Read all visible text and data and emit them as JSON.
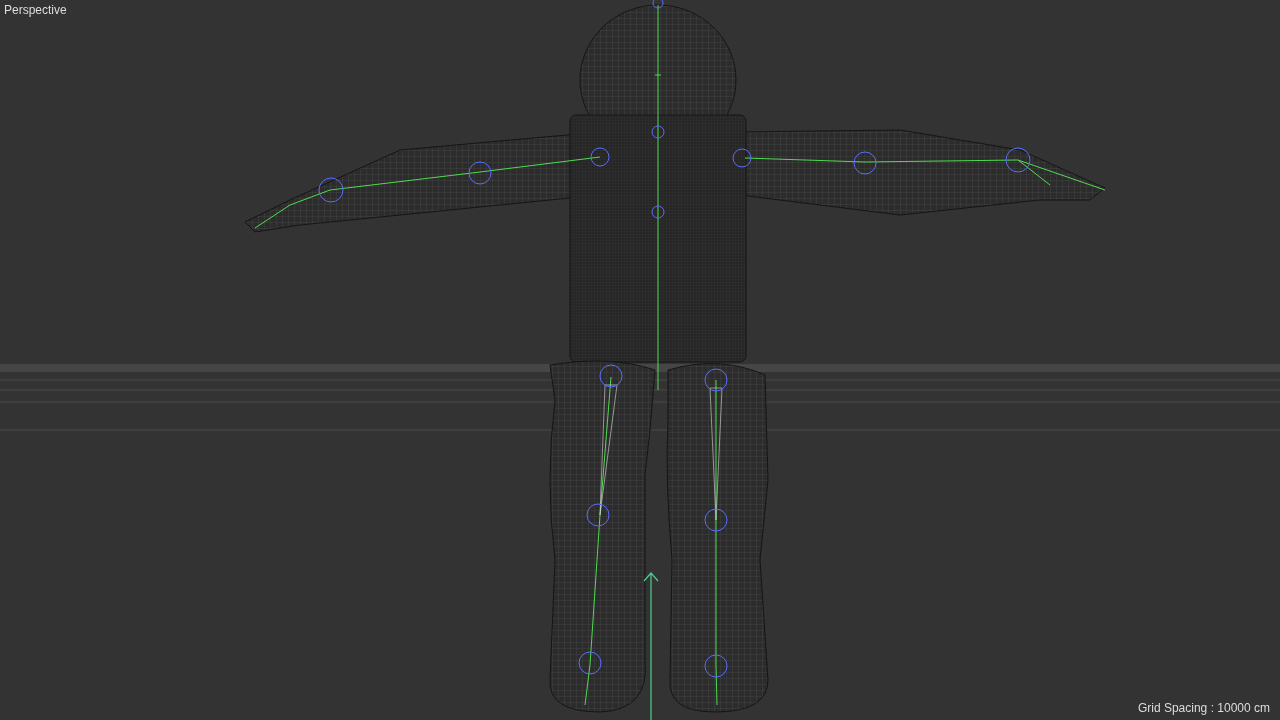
{
  "viewport": {
    "title": "Perspective",
    "grid_spacing": "Grid Spacing : 10000 cm"
  }
}
